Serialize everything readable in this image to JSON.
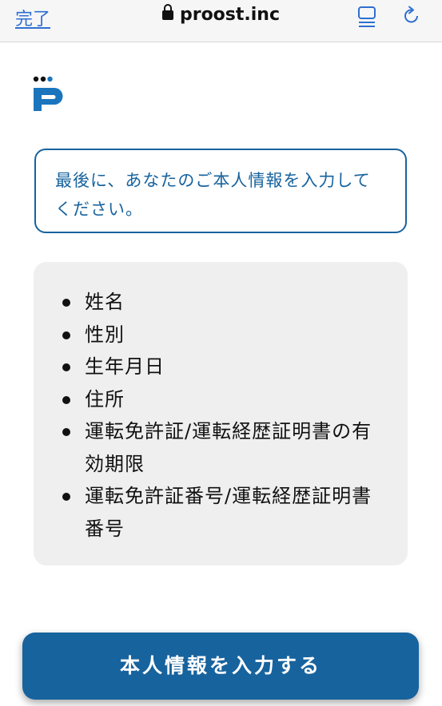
{
  "browser": {
    "done_label": "完了",
    "url": "proost.inc",
    "icons": {
      "lock": "lock-icon",
      "reader": "reader-mode-icon",
      "reload": "reload-icon"
    }
  },
  "brand": {
    "logo": "proost-logo",
    "color": "#17639e"
  },
  "notice": {
    "text": "最後に、あなたのご本人情報を入力してください。"
  },
  "requirements": {
    "items": [
      "姓名",
      "性別",
      "生年月日",
      "住所",
      "運転免許証/運転経歴証明書の有効期限",
      "運転免許証番号/運転経歴証明書番号"
    ]
  },
  "actions": {
    "submit_label": "本人情報を入力する"
  }
}
